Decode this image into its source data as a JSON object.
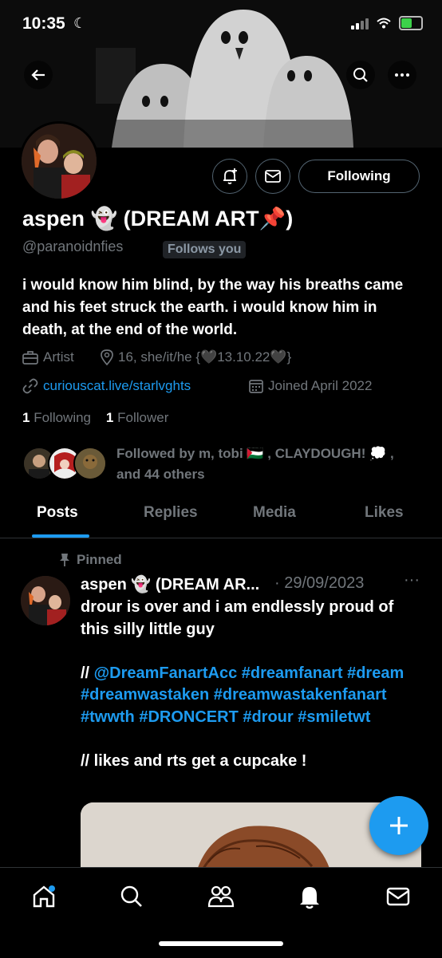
{
  "status_bar": {
    "time": "10:35"
  },
  "profile": {
    "name": "aspen 👻 (DREAM ART📌)",
    "handle": "@paranoidnfies",
    "follows_you": "Follows you",
    "follow_button": "Following",
    "bio": "i would know him blind, by the way his breaths came and his feet struck the earth. i would know him in death, at the end of the world.",
    "category": "Artist",
    "location": "16, she/it/he {🖤13.10.22🖤}",
    "link": "curiouscat.live/starlvghts",
    "joined": "Joined April 2022",
    "following_count": "1",
    "following_label": "Following",
    "followers_count": "1",
    "followers_label": "Follower",
    "followed_by": "Followed by m, tobi 🇵🇸 , CLAYDOUGH! 💭 , and 44 others"
  },
  "tabs": [
    "Posts",
    "Replies",
    "Media",
    "Likes"
  ],
  "active_tab": "Posts",
  "post": {
    "pinned_label": "Pinned",
    "author": "aspen 👻 (DREAM AR...",
    "date": "· 29/09/2023",
    "more": "···",
    "line1": "drour is over and i am endlessly proud of this silly little guy",
    "tags_prefix": "// ",
    "tags": "@DreamFanartAcc #dreamfanart #dream #dreamwastaken #dreamwastakenfanart #twwth #DRONCERT #drour #smiletwt",
    "line3": "// likes and rts get a cupcake !"
  },
  "icons": {
    "back": "back-arrow-icon",
    "search": "search-icon",
    "more": "more-icon",
    "notify": "notification-bell-plus-icon",
    "message": "envelope-icon",
    "compose": "plus-icon"
  },
  "colors": {
    "accent": "#1d9bf0",
    "background": "#000000",
    "muted": "#71767b"
  }
}
